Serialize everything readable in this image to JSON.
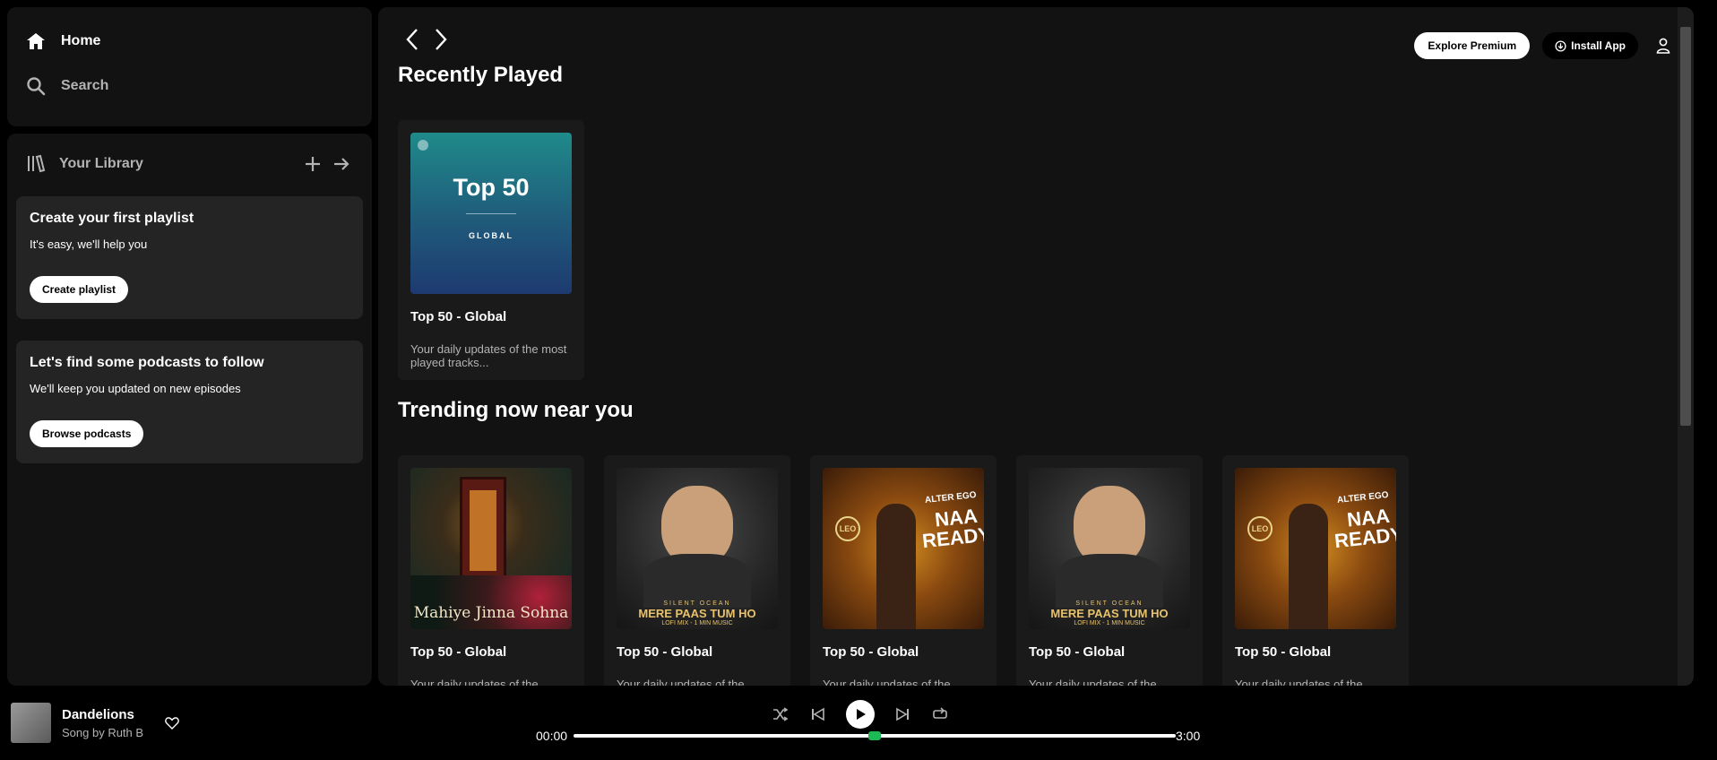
{
  "nav": {
    "home_label": "Home",
    "search_label": "Search"
  },
  "library": {
    "title": "Your Library",
    "playlist_prompt": {
      "heading": "Create your first playlist",
      "subtext": "It's easy, we'll help you",
      "button": "Create playlist"
    },
    "podcast_prompt": {
      "heading": "Let's find some podcasts to follow",
      "subtext": "We'll keep you updated on new episodes",
      "button": "Browse podcasts"
    }
  },
  "topbar": {
    "premium_label": "Explore Premium",
    "install_label": "Install App"
  },
  "recently_played": {
    "title": "Recently Played",
    "items": [
      {
        "art_title": "Top 50",
        "art_sub": "GLOBAL",
        "title": "Top 50 - Global",
        "desc": "Your daily updates of the most played tracks..."
      }
    ]
  },
  "trending": {
    "title": "Trending now near you",
    "items": [
      {
        "art_text": "Mahiye Jinna Sohna",
        "title": "Top 50 - Global",
        "desc": "Your daily updates of the"
      },
      {
        "art_text": "MERE PAAS TUM HO",
        "art_sub": "LOFI MIX - 1 MIN MUSIC",
        "art_top": "SILENT OCEAN",
        "title": "Top 50 - Global",
        "desc": "Your daily updates of the"
      },
      {
        "art_text": "NAA READY",
        "art_top": "ALTER EGO",
        "art_badge": "LEO",
        "title": "Top 50 - Global",
        "desc": "Your daily updates of the"
      },
      {
        "art_text": "MERE PAAS TUM HO",
        "art_sub": "LOFI MIX - 1 MIN MUSIC",
        "art_top": "SILENT OCEAN",
        "title": "Top 50 - Global",
        "desc": "Your daily updates of the"
      },
      {
        "art_text": "NAA READY",
        "art_top": "ALTER EGO",
        "art_badge": "LEO",
        "title": "Top 50 - Global",
        "desc": "Your daily updates of the"
      }
    ]
  },
  "player": {
    "song": "Dandelions",
    "artist": "Song by Ruth B",
    "elapsed": "00:00",
    "duration": "3:00",
    "progress": 0.5
  },
  "colors": {
    "accent": "#1db954",
    "panel": "#121212",
    "card": "#1a1a1a"
  }
}
